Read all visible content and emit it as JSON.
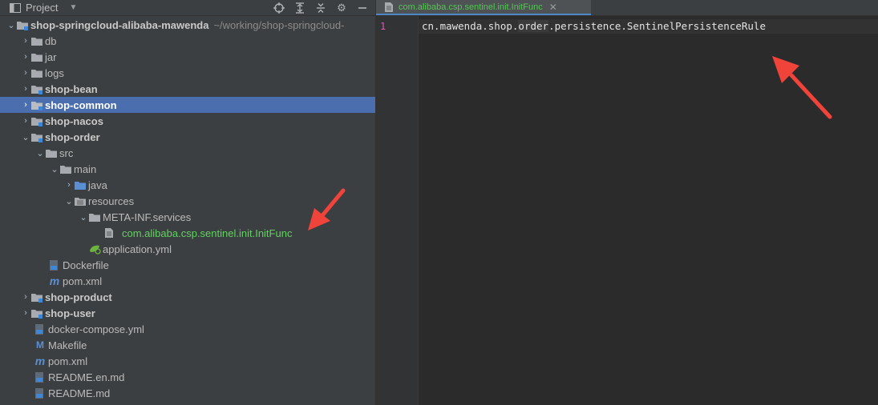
{
  "panel": {
    "title": "Project"
  },
  "tree": [
    {
      "label": "shop-springcloud-alibaba-mawenda",
      "path": "~/working/shop-springcloud-",
      "bold": true
    },
    {
      "label": "db"
    },
    {
      "label": "jar"
    },
    {
      "label": "logs"
    },
    {
      "label": "shop-bean",
      "bold": true
    },
    {
      "label": "shop-common",
      "bold": true,
      "selected": true
    },
    {
      "label": "shop-nacos",
      "bold": true
    },
    {
      "label": "shop-order",
      "bold": true
    },
    {
      "label": "src"
    },
    {
      "label": "main"
    },
    {
      "label": "java"
    },
    {
      "label": "resources"
    },
    {
      "label": "META-INF.services"
    },
    {
      "label": "com.alibaba.csp.sentinel.init.InitFunc"
    },
    {
      "label": "application.yml"
    },
    {
      "label": "Dockerfile"
    },
    {
      "label": "pom.xml"
    },
    {
      "label": "shop-product",
      "bold": true
    },
    {
      "label": "shop-user",
      "bold": true
    },
    {
      "label": "docker-compose.yml"
    },
    {
      "label": "Makefile"
    },
    {
      "label": "pom.xml"
    },
    {
      "label": "README.en.md"
    },
    {
      "label": "README.md"
    }
  ],
  "editor": {
    "tab_label": "com.alibaba.csp.sentinel.init.InitFunc",
    "line_number": "1",
    "code_parts": [
      "cn.mawenda.shop.",
      "order",
      ".persistence.SentinelPersistenceRule"
    ]
  },
  "colors": {
    "accent": "#4b6eaf",
    "annotation": "#f0433a",
    "green_file": "#5fd35f"
  }
}
